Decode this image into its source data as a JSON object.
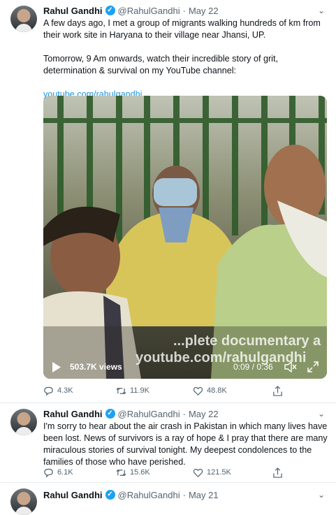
{
  "tweets": [
    {
      "name": "Rahul Gandhi",
      "handle": "@RahulGandhi",
      "separator": "·",
      "date": "May 22",
      "text_para1": "A few days ago, I met a group of migrants walking hundreds of km from their work site in Haryana to their village near Jhansi, UP.",
      "text_para2": "Tomorrow, 9 Am onwards, watch their incredible story of grit, determination & survival on my YouTube channel:",
      "link": "youtube.com/rahulgandhi",
      "video": {
        "overlay_line1": "...plete documentary a",
        "overlay_line2": "youtube.com/rahulgandhi",
        "views": "503.7K views",
        "time": "0:09 / 0:36"
      },
      "replies": "4.3K",
      "retweets": "11.9K",
      "likes": "48.8K"
    },
    {
      "name": "Rahul Gandhi",
      "handle": "@RahulGandhi",
      "separator": "·",
      "date": "May 22",
      "text": "I'm sorry to hear about the air crash in Pakistan in which many lives have been lost. News of survivors is a ray of hope & I pray that there are many miraculous stories of survival tonight. My deepest condolences to the families of those who have perished.",
      "replies": "6.1K",
      "retweets": "15.6K",
      "likes": "121.5K"
    },
    {
      "name": "Rahul Gandhi",
      "handle": "@RahulGandhi",
      "separator": "·",
      "date": "May 21"
    }
  ],
  "icons": {
    "verified": "verified-badge-icon",
    "caret": "chevron-down-icon",
    "reply": "reply-icon",
    "retweet": "retweet-icon",
    "like": "heart-icon",
    "share": "share-icon",
    "play": "play-icon",
    "mute": "mute-icon",
    "fullscreen": "fullscreen-icon"
  },
  "colors": {
    "link": "#1b95e0",
    "verified": "#1da1f2",
    "muted": "#536471"
  }
}
